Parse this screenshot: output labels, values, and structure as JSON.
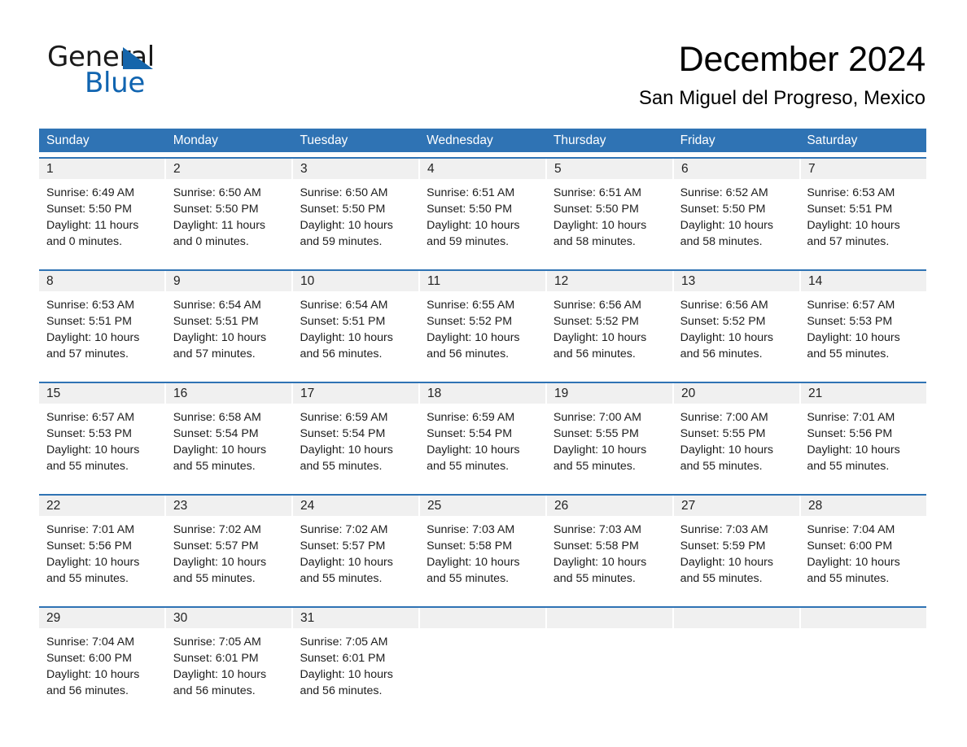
{
  "brand": {
    "name_part1": "General",
    "name_part2": "Blue",
    "triangle_color": "#1565ab",
    "blue_text_color": "#1064b0"
  },
  "header": {
    "month_title": "December 2024",
    "location": "San Miguel del Progreso, Mexico"
  },
  "theme": {
    "header_blue": "#2f73b4",
    "daynum_band": "#f0f0f0",
    "row_rule": "#2f73b4"
  },
  "weekdays": [
    "Sunday",
    "Monday",
    "Tuesday",
    "Wednesday",
    "Thursday",
    "Friday",
    "Saturday"
  ],
  "weeks": [
    {
      "days": [
        {
          "num": "1",
          "sunrise": "Sunrise: 6:49 AM",
          "sunset": "Sunset: 5:50 PM",
          "daylight1": "Daylight: 11 hours",
          "daylight2": "and 0 minutes."
        },
        {
          "num": "2",
          "sunrise": "Sunrise: 6:50 AM",
          "sunset": "Sunset: 5:50 PM",
          "daylight1": "Daylight: 11 hours",
          "daylight2": "and 0 minutes."
        },
        {
          "num": "3",
          "sunrise": "Sunrise: 6:50 AM",
          "sunset": "Sunset: 5:50 PM",
          "daylight1": "Daylight: 10 hours",
          "daylight2": "and 59 minutes."
        },
        {
          "num": "4",
          "sunrise": "Sunrise: 6:51 AM",
          "sunset": "Sunset: 5:50 PM",
          "daylight1": "Daylight: 10 hours",
          "daylight2": "and 59 minutes."
        },
        {
          "num": "5",
          "sunrise": "Sunrise: 6:51 AM",
          "sunset": "Sunset: 5:50 PM",
          "daylight1": "Daylight: 10 hours",
          "daylight2": "and 58 minutes."
        },
        {
          "num": "6",
          "sunrise": "Sunrise: 6:52 AM",
          "sunset": "Sunset: 5:50 PM",
          "daylight1": "Daylight: 10 hours",
          "daylight2": "and 58 minutes."
        },
        {
          "num": "7",
          "sunrise": "Sunrise: 6:53 AM",
          "sunset": "Sunset: 5:51 PM",
          "daylight1": "Daylight: 10 hours",
          "daylight2": "and 57 minutes."
        }
      ]
    },
    {
      "days": [
        {
          "num": "8",
          "sunrise": "Sunrise: 6:53 AM",
          "sunset": "Sunset: 5:51 PM",
          "daylight1": "Daylight: 10 hours",
          "daylight2": "and 57 minutes."
        },
        {
          "num": "9",
          "sunrise": "Sunrise: 6:54 AM",
          "sunset": "Sunset: 5:51 PM",
          "daylight1": "Daylight: 10 hours",
          "daylight2": "and 57 minutes."
        },
        {
          "num": "10",
          "sunrise": "Sunrise: 6:54 AM",
          "sunset": "Sunset: 5:51 PM",
          "daylight1": "Daylight: 10 hours",
          "daylight2": "and 56 minutes."
        },
        {
          "num": "11",
          "sunrise": "Sunrise: 6:55 AM",
          "sunset": "Sunset: 5:52 PM",
          "daylight1": "Daylight: 10 hours",
          "daylight2": "and 56 minutes."
        },
        {
          "num": "12",
          "sunrise": "Sunrise: 6:56 AM",
          "sunset": "Sunset: 5:52 PM",
          "daylight1": "Daylight: 10 hours",
          "daylight2": "and 56 minutes."
        },
        {
          "num": "13",
          "sunrise": "Sunrise: 6:56 AM",
          "sunset": "Sunset: 5:52 PM",
          "daylight1": "Daylight: 10 hours",
          "daylight2": "and 56 minutes."
        },
        {
          "num": "14",
          "sunrise": "Sunrise: 6:57 AM",
          "sunset": "Sunset: 5:53 PM",
          "daylight1": "Daylight: 10 hours",
          "daylight2": "and 55 minutes."
        }
      ]
    },
    {
      "days": [
        {
          "num": "15",
          "sunrise": "Sunrise: 6:57 AM",
          "sunset": "Sunset: 5:53 PM",
          "daylight1": "Daylight: 10 hours",
          "daylight2": "and 55 minutes."
        },
        {
          "num": "16",
          "sunrise": "Sunrise: 6:58 AM",
          "sunset": "Sunset: 5:54 PM",
          "daylight1": "Daylight: 10 hours",
          "daylight2": "and 55 minutes."
        },
        {
          "num": "17",
          "sunrise": "Sunrise: 6:59 AM",
          "sunset": "Sunset: 5:54 PM",
          "daylight1": "Daylight: 10 hours",
          "daylight2": "and 55 minutes."
        },
        {
          "num": "18",
          "sunrise": "Sunrise: 6:59 AM",
          "sunset": "Sunset: 5:54 PM",
          "daylight1": "Daylight: 10 hours",
          "daylight2": "and 55 minutes."
        },
        {
          "num": "19",
          "sunrise": "Sunrise: 7:00 AM",
          "sunset": "Sunset: 5:55 PM",
          "daylight1": "Daylight: 10 hours",
          "daylight2": "and 55 minutes."
        },
        {
          "num": "20",
          "sunrise": "Sunrise: 7:00 AM",
          "sunset": "Sunset: 5:55 PM",
          "daylight1": "Daylight: 10 hours",
          "daylight2": "and 55 minutes."
        },
        {
          "num": "21",
          "sunrise": "Sunrise: 7:01 AM",
          "sunset": "Sunset: 5:56 PM",
          "daylight1": "Daylight: 10 hours",
          "daylight2": "and 55 minutes."
        }
      ]
    },
    {
      "days": [
        {
          "num": "22",
          "sunrise": "Sunrise: 7:01 AM",
          "sunset": "Sunset: 5:56 PM",
          "daylight1": "Daylight: 10 hours",
          "daylight2": "and 55 minutes."
        },
        {
          "num": "23",
          "sunrise": "Sunrise: 7:02 AM",
          "sunset": "Sunset: 5:57 PM",
          "daylight1": "Daylight: 10 hours",
          "daylight2": "and 55 minutes."
        },
        {
          "num": "24",
          "sunrise": "Sunrise: 7:02 AM",
          "sunset": "Sunset: 5:57 PM",
          "daylight1": "Daylight: 10 hours",
          "daylight2": "and 55 minutes."
        },
        {
          "num": "25",
          "sunrise": "Sunrise: 7:03 AM",
          "sunset": "Sunset: 5:58 PM",
          "daylight1": "Daylight: 10 hours",
          "daylight2": "and 55 minutes."
        },
        {
          "num": "26",
          "sunrise": "Sunrise: 7:03 AM",
          "sunset": "Sunset: 5:58 PM",
          "daylight1": "Daylight: 10 hours",
          "daylight2": "and 55 minutes."
        },
        {
          "num": "27",
          "sunrise": "Sunrise: 7:03 AM",
          "sunset": "Sunset: 5:59 PM",
          "daylight1": "Daylight: 10 hours",
          "daylight2": "and 55 minutes."
        },
        {
          "num": "28",
          "sunrise": "Sunrise: 7:04 AM",
          "sunset": "Sunset: 6:00 PM",
          "daylight1": "Daylight: 10 hours",
          "daylight2": "and 55 minutes."
        }
      ]
    },
    {
      "days": [
        {
          "num": "29",
          "sunrise": "Sunrise: 7:04 AM",
          "sunset": "Sunset: 6:00 PM",
          "daylight1": "Daylight: 10 hours",
          "daylight2": "and 56 minutes."
        },
        {
          "num": "30",
          "sunrise": "Sunrise: 7:05 AM",
          "sunset": "Sunset: 6:01 PM",
          "daylight1": "Daylight: 10 hours",
          "daylight2": "and 56 minutes."
        },
        {
          "num": "31",
          "sunrise": "Sunrise: 7:05 AM",
          "sunset": "Sunset: 6:01 PM",
          "daylight1": "Daylight: 10 hours",
          "daylight2": "and 56 minutes."
        },
        {
          "num": "",
          "sunrise": "",
          "sunset": "",
          "daylight1": "",
          "daylight2": ""
        },
        {
          "num": "",
          "sunrise": "",
          "sunset": "",
          "daylight1": "",
          "daylight2": ""
        },
        {
          "num": "",
          "sunrise": "",
          "sunset": "",
          "daylight1": "",
          "daylight2": ""
        },
        {
          "num": "",
          "sunrise": "",
          "sunset": "",
          "daylight1": "",
          "daylight2": ""
        }
      ]
    }
  ]
}
